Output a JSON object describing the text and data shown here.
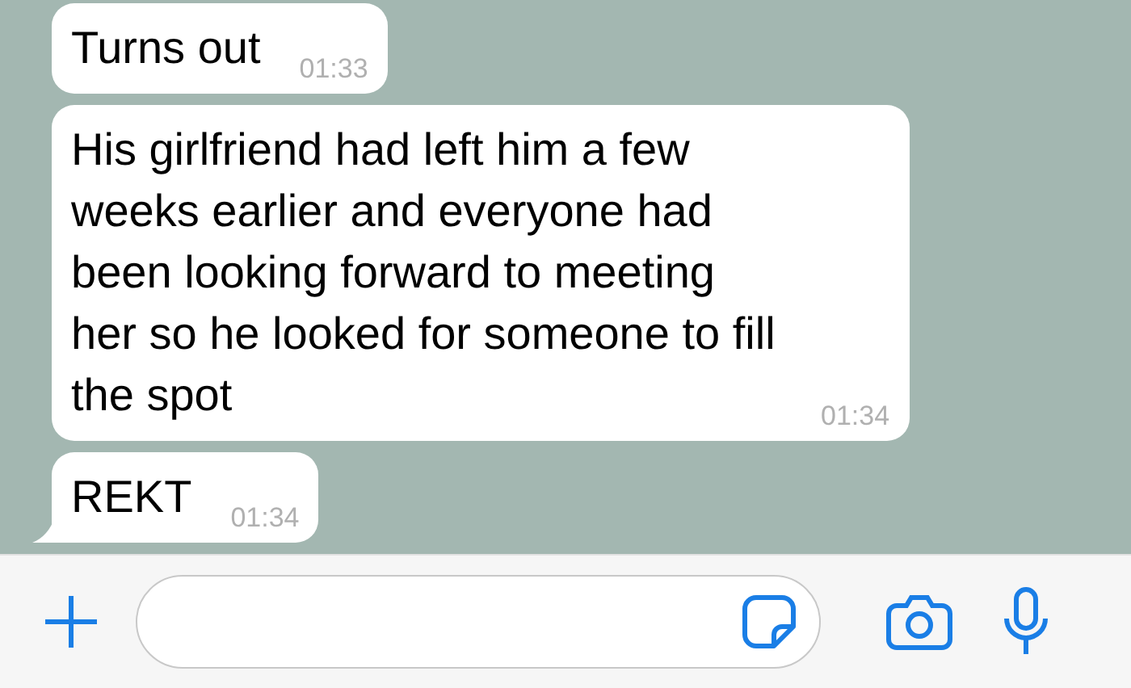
{
  "messages": [
    {
      "text": "Turns out",
      "time": "01:33",
      "tail": false
    },
    {
      "text": "His girlfriend had left him a few weeks earlier and everyone had been looking forward to meeting her so he looked for someone to fill the spot",
      "time": "01:34",
      "tail": false
    },
    {
      "text": "REKT",
      "time": "01:34",
      "tail": true
    }
  ]
}
